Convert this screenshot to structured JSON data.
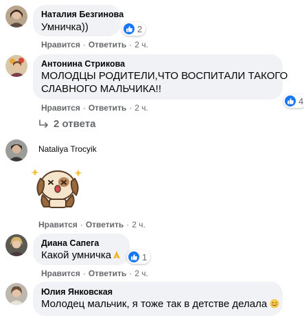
{
  "colors": {
    "bubble": "#f0f2f5",
    "meta_text": "#65676b",
    "like_blue": "#1877f2"
  },
  "actions": {
    "like": "Нравится",
    "reply": "Ответить",
    "separator": "·"
  },
  "comments": [
    {
      "author": "Наталия Безгинова",
      "text_lines": [
        "Умничка))"
      ],
      "reaction_count": "2",
      "reaction_icon": "like-icon",
      "time": "2 ч."
    },
    {
      "author": "Антонина Стрикова",
      "text_lines": [
        "МОЛОДЦЫ РОДИТЕЛИ,ЧТО ВОСПИТАЛИ ТАКОГО",
        "СЛАВНОГО МАЛЬЧИКА!!"
      ],
      "reaction_count": "4",
      "reaction_icon": "like-icon",
      "time": "2 ч.",
      "replies_label": "2 ответа",
      "replies_icon": "reply-arrow-icon"
    },
    {
      "author": "Nataliya Trocyik",
      "sticker": "puppy-sticker",
      "time": "2 ч."
    },
    {
      "author": "Диана Сапега",
      "text_lines": [
        "Какой умничка"
      ],
      "text_emoji": "pray-emoji",
      "reaction_count": "1",
      "reaction_icon": "like-icon",
      "time": "2 ч."
    },
    {
      "author": "Юлия Янковская",
      "text_lines": [
        "Молодец мальчик, я тоже так в детстве делала"
      ],
      "text_emoji": "smiling-emoji"
    }
  ]
}
